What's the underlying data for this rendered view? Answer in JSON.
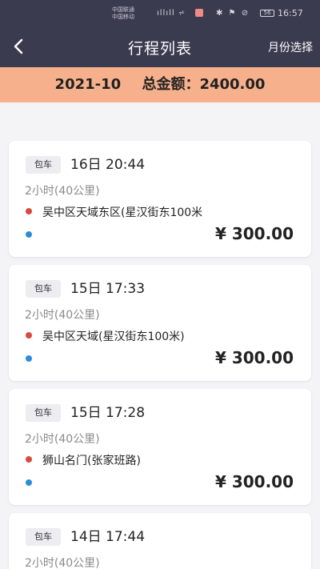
{
  "status_bar": {
    "carrier_1": "中国联通",
    "carrier_2": "中国移动",
    "signal_icons": "ıllıll ⩫",
    "system_icons": "✱ ⚑ ⊘",
    "battery": "56",
    "time": "16:57"
  },
  "nav": {
    "back_icon": "chevron-left-icon",
    "title": "行程列表",
    "right_action": "月份选择"
  },
  "summary": {
    "month": "2021-10",
    "total_label": "总金额：2400.00"
  },
  "trips": [
    {
      "tag": "包车",
      "datetime": "16日 20:44",
      "duration": "2小时(40公里)",
      "start": "吴中区天域东区(星汉街东100米",
      "end": "",
      "price": "¥ 300.00"
    },
    {
      "tag": "包车",
      "datetime": "15日 17:33",
      "duration": "2小时(40公里)",
      "start": "吴中区天域(星汉街东100米)",
      "end": "",
      "price": "¥ 300.00"
    },
    {
      "tag": "包车",
      "datetime": "15日 17:28",
      "duration": "2小时(40公里)",
      "start": "狮山名门(张家班路)",
      "end": "",
      "price": "¥ 300.00"
    },
    {
      "tag": "包车",
      "datetime": "14日 17:44",
      "duration": "2小时(40公里)",
      "start": "",
      "end": "",
      "price": ""
    }
  ],
  "colors": {
    "header_bg": "#3a3b4f",
    "summary_bg": "#f6b08b",
    "start_dot": "#d94a3d",
    "end_dot": "#2b8fd8"
  }
}
